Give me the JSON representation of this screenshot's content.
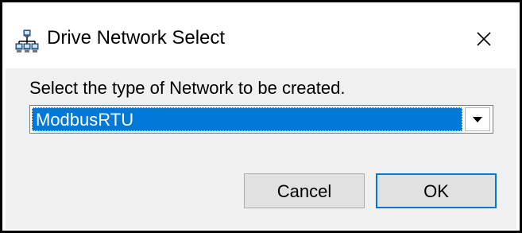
{
  "window": {
    "title": "Drive Network Select",
    "title_icon": "network-icon",
    "close_icon": "close-icon"
  },
  "form": {
    "prompt": "Select the type of Network to be created.",
    "network_type": {
      "selected": "ModbusRTU",
      "arrow_icon": "chevron-down-icon"
    }
  },
  "buttons": {
    "cancel": "Cancel",
    "ok": "OK"
  },
  "colors": {
    "selection": "#0078d7",
    "client_bg": "#f0f0f0",
    "button_bg": "#e1e1e1"
  }
}
